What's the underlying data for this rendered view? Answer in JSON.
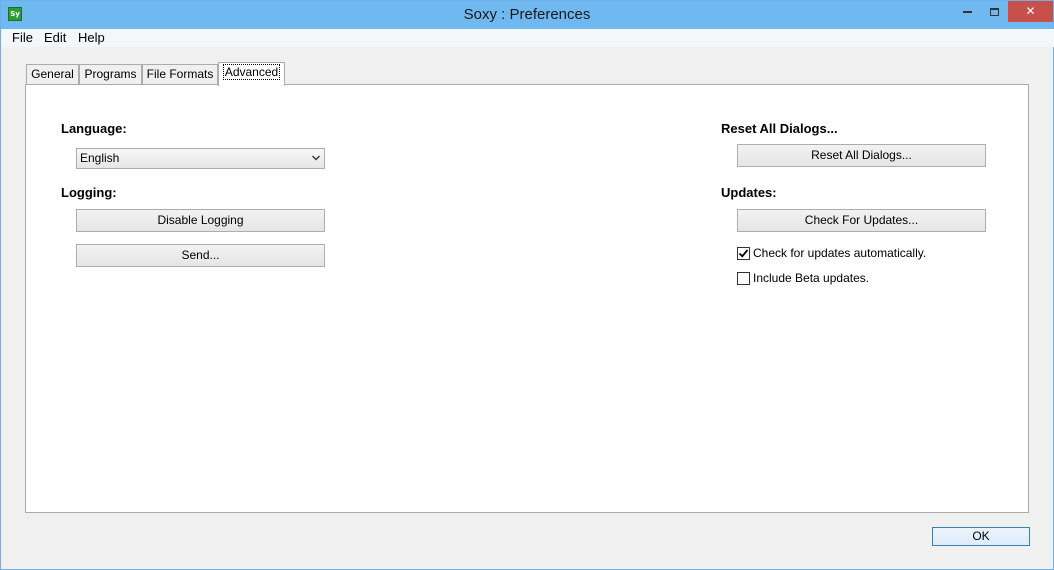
{
  "window": {
    "title": "Soxy : Preferences",
    "app_icon_text": "Sy",
    "accent_color": "#6fb8f0",
    "close_color": "#c7504b",
    "close_glyph": "✕"
  },
  "menu": {
    "items": [
      {
        "label": "File"
      },
      {
        "label": "Edit"
      },
      {
        "label": "Help"
      }
    ]
  },
  "tabs": [
    {
      "label": "General",
      "active": false
    },
    {
      "label": "Programs",
      "active": false
    },
    {
      "label": "File Formats",
      "active": false
    },
    {
      "label": "Advanced",
      "active": true
    }
  ],
  "advanced": {
    "language": {
      "heading": "Language:",
      "selected": "English"
    },
    "logging": {
      "heading": "Logging:",
      "disable_label": "Disable Logging",
      "send_label": "Send..."
    },
    "reset": {
      "heading": "Reset All Dialogs...",
      "button_label": "Reset All Dialogs..."
    },
    "updates": {
      "heading": "Updates:",
      "check_button_label": "Check For Updates...",
      "auto_check_label": "Check for updates automatically.",
      "auto_check_checked": true,
      "beta_label": "Include Beta updates.",
      "beta_checked": false
    }
  },
  "footer": {
    "ok_label": "OK"
  }
}
